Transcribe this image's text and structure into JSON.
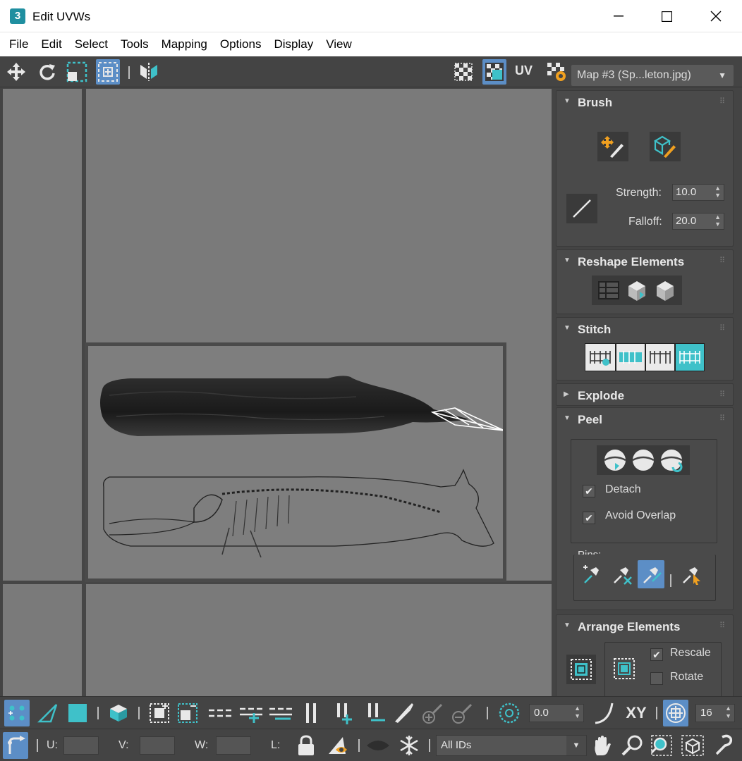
{
  "window": {
    "title": "Edit UVWs",
    "app_icon": "3",
    "minimize": "—",
    "maximize": "☐",
    "close": "✕"
  },
  "menu": [
    "File",
    "Edit",
    "Select",
    "Tools",
    "Mapping",
    "Options",
    "Display",
    "View"
  ],
  "toolbar": {
    "uv_label": "UV",
    "map_selector": "Map #3 (Sp...leton.jpg)"
  },
  "colors": {
    "accent_teal": "#3fc1c9",
    "active_blue": "#5c8ec6",
    "icon_orange": "#f0a020"
  },
  "panel": {
    "brush": {
      "title": "Brush",
      "strength_label": "Strength:",
      "strength_value": "10.0",
      "falloff_label": "Falloff:",
      "falloff_value": "20.0"
    },
    "reshape": {
      "title": "Reshape Elements"
    },
    "stitch": {
      "title": "Stitch"
    },
    "explode": {
      "title": "Explode"
    },
    "peel": {
      "title": "Peel",
      "detach_label": "Detach",
      "detach_checked": true,
      "avoid_overlap_label": "Avoid Overlap",
      "avoid_overlap_checked": true,
      "pins_label": "Pins:"
    },
    "arrange": {
      "title": "Arrange Elements",
      "rescale_label": "Rescale",
      "rescale_checked": true,
      "rotate_label": "Rotate",
      "rotate_checked": false
    }
  },
  "bottom": {
    "angle_value": "0.0",
    "xy_label": "XY",
    "grid_value": "16",
    "u_label": "U:",
    "v_label": "V:",
    "w_label": "W:",
    "l_label": "L:",
    "ids_value": "All IDs"
  },
  "check_glyph": "✔"
}
